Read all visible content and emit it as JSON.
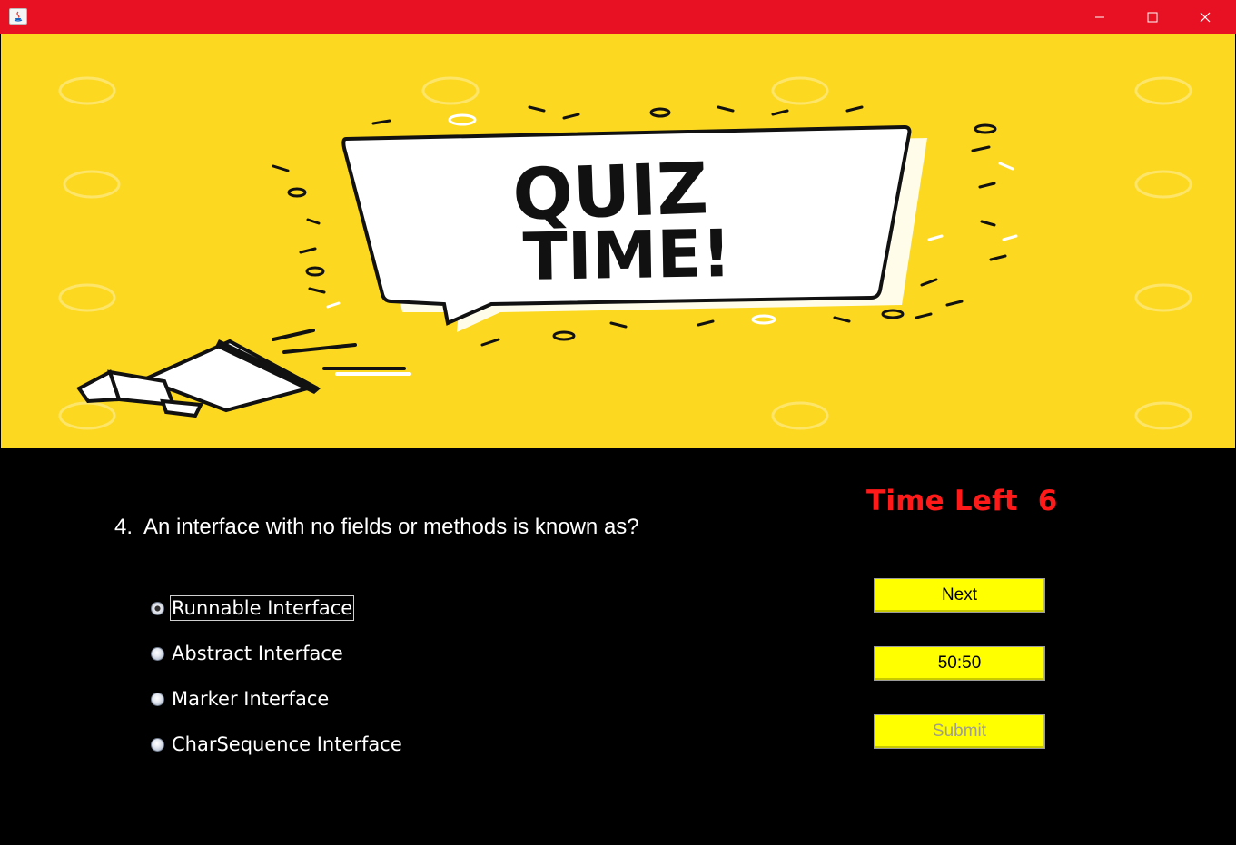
{
  "window": {
    "title": "",
    "titlebar_color": "#e81123"
  },
  "banner": {
    "headline_line1": "QUIZ",
    "headline_line2": "TIME!",
    "background_color": "#fcd920"
  },
  "timer": {
    "label": "Time Left  6"
  },
  "question": {
    "text": "4.  An interface with no fields or methods is known as?"
  },
  "options": [
    {
      "label": "Runnable Interface",
      "selected": true
    },
    {
      "label": "Abstract Interface",
      "selected": false
    },
    {
      "label": "Marker Interface",
      "selected": false
    },
    {
      "label": "CharSequence Interface",
      "selected": false
    }
  ],
  "buttons": {
    "next": "Next",
    "fifty_fifty": "50:50",
    "submit": "Submit"
  },
  "colors": {
    "button_bg": "#ffff00",
    "timer_text": "#ff1a1a",
    "content_bg": "#000000"
  }
}
